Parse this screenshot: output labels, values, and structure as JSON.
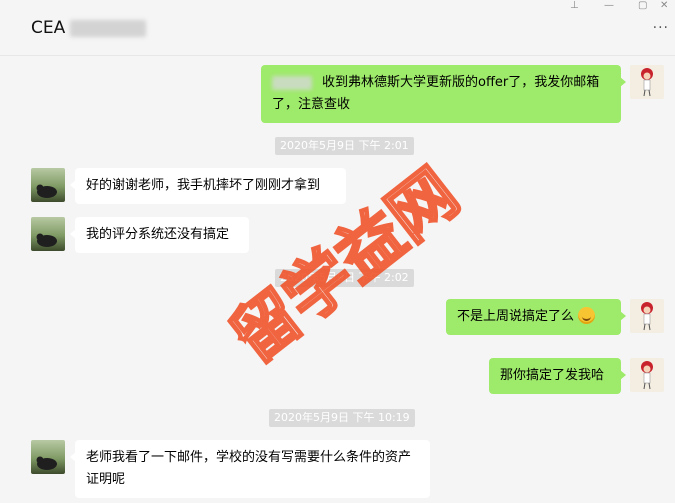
{
  "window": {
    "title": "CEA",
    "controls": [
      "⊥",
      "—",
      "▢",
      "✕"
    ],
    "more_label": "···"
  },
  "messages": [
    {
      "side": "right",
      "text": "收到弗林德斯大学更新版的offer了，我发你邮箱了，注意查收",
      "emoji": false
    },
    {
      "timestamp": "2020年5月9日 下午 2:01"
    },
    {
      "side": "left",
      "text": "好的谢谢老师，我手机摔坏了刚刚才拿到"
    },
    {
      "side": "left",
      "text": "我的评分系统还没有搞定"
    },
    {
      "timestamp": "2020年5月9日 下午 2:02"
    },
    {
      "side": "right",
      "text": "不是上周说搞定了么",
      "emoji": true,
      "emoji_icon": "sweat-smile-emoji"
    },
    {
      "side": "right",
      "text": "那你搞定了发我哈"
    },
    {
      "timestamp": "2020年5月9日 下午 10:19"
    },
    {
      "side": "left",
      "text": "老师我看了一下邮件，学校的没有写需要什么条件的资产证明呢"
    }
  ],
  "watermark": {
    "text": "留学益网",
    "color": "#f0552d"
  },
  "colors": {
    "sent_bubble": "#9eea6a",
    "received_bubble": "#ffffff",
    "background": "#f5f5f5"
  }
}
